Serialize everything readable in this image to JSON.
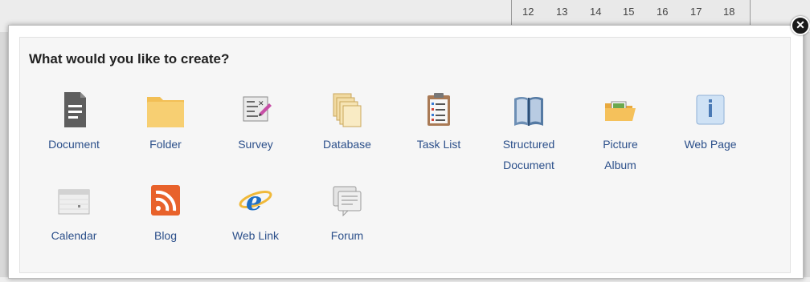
{
  "background": {
    "calendar_days": [
      "12",
      "13",
      "14",
      "15",
      "16",
      "17",
      "18"
    ]
  },
  "dialog": {
    "title": "What would you like to create?",
    "close_icon": "close-icon",
    "items": [
      {
        "label": "Document",
        "icon": "document-icon"
      },
      {
        "label": "Folder",
        "icon": "folder-icon"
      },
      {
        "label": "Survey",
        "icon": "survey-icon"
      },
      {
        "label": "Database",
        "icon": "database-icon"
      },
      {
        "label": "Task List",
        "icon": "task-list-icon"
      },
      {
        "label_line1": "Structured",
        "label_line2": "Document",
        "icon": "structured-document-icon"
      },
      {
        "label_line1": "Picture",
        "label_line2": "Album",
        "icon": "picture-album-icon"
      },
      {
        "label": "Web Page",
        "icon": "web-page-icon"
      },
      {
        "label": "Calendar",
        "icon": "calendar-icon"
      },
      {
        "label": "Blog",
        "icon": "blog-icon"
      },
      {
        "label": "Web Link",
        "icon": "web-link-icon"
      },
      {
        "label": "Forum",
        "icon": "forum-icon"
      }
    ]
  },
  "colors": {
    "link_text": "#2b4f8a",
    "title_text": "#222222"
  }
}
